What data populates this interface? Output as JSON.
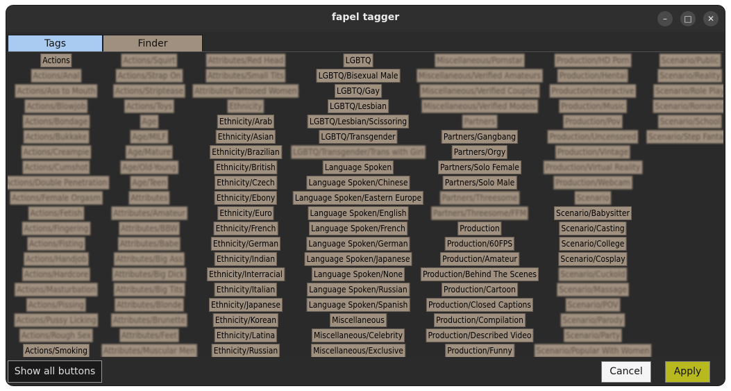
{
  "window": {
    "title": "fapel tagger",
    "minimize_glyph": "–",
    "maximize_glyph": "□",
    "close_glyph": "✕"
  },
  "tabs": [
    {
      "label": "Tags",
      "active": true
    },
    {
      "label": "Finder",
      "active": false
    }
  ],
  "tag_columns": [
    {
      "tags": [
        {
          "label": "Actions",
          "blurred": false
        },
        {
          "label": "Actions/Anal",
          "blurred": true
        },
        {
          "label": "Actions/Ass to Mouth",
          "blurred": true
        },
        {
          "label": "Actions/Blowjob",
          "blurred": true
        },
        {
          "label": "Actions/Bondage",
          "blurred": true
        },
        {
          "label": "Actions/Bukkake",
          "blurred": true
        },
        {
          "label": "Actions/Creampie",
          "blurred": true
        },
        {
          "label": "Actions/Cumshot",
          "blurred": true
        },
        {
          "label": "Actions/Double Penetration",
          "blurred": true
        },
        {
          "label": "Actions/Female Orgasm",
          "blurred": true
        },
        {
          "label": "Actions/Fetish",
          "blurred": true
        },
        {
          "label": "Actions/Fingering",
          "blurred": true
        },
        {
          "label": "Actions/Fisting",
          "blurred": true
        },
        {
          "label": "Actions/Handjob",
          "blurred": true
        },
        {
          "label": "Actions/Hardcore",
          "blurred": true
        },
        {
          "label": "Actions/Masturbation",
          "blurred": true
        },
        {
          "label": "Actions/Pissing",
          "blurred": true
        },
        {
          "label": "Actions/Pussy Licking",
          "blurred": true
        },
        {
          "label": "Actions/Rough Sex",
          "blurred": true
        },
        {
          "label": "Actions/Smoking",
          "blurred": false
        }
      ]
    },
    {
      "tags": [
        {
          "label": "Actions/Squirt",
          "blurred": true
        },
        {
          "label": "Actions/Strap On",
          "blurred": true
        },
        {
          "label": "Actions/Striptease",
          "blurred": true
        },
        {
          "label": "Actions/Toys",
          "blurred": true
        },
        {
          "label": "Age",
          "blurred": true
        },
        {
          "label": "Age/MILF",
          "blurred": true
        },
        {
          "label": "Age/Mature",
          "blurred": true
        },
        {
          "label": "Age/Old-Young",
          "blurred": true
        },
        {
          "label": "Age/Teen",
          "blurred": true
        },
        {
          "label": "Attributes",
          "blurred": true
        },
        {
          "label": "Attributes/Amateur",
          "blurred": true
        },
        {
          "label": "Attributes/BBW",
          "blurred": true
        },
        {
          "label": "Attributes/Babe",
          "blurred": true
        },
        {
          "label": "Attributes/Big Ass",
          "blurred": true
        },
        {
          "label": "Attributes/Big Dick",
          "blurred": true
        },
        {
          "label": "Attributes/Big Tits",
          "blurred": true
        },
        {
          "label": "Attributes/Blonde",
          "blurred": true
        },
        {
          "label": "Attributes/Brunette",
          "blurred": true
        },
        {
          "label": "Attributes/Feet",
          "blurred": true
        },
        {
          "label": "Attributes/Muscular Men",
          "blurred": true
        }
      ]
    },
    {
      "tags": [
        {
          "label": "Attributes/Red Head",
          "blurred": true
        },
        {
          "label": "Attributes/Small Tits",
          "blurred": true
        },
        {
          "label": "Attributes/Tattooed Women",
          "blurred": true
        },
        {
          "label": "Ethnicity",
          "blurred": true
        },
        {
          "label": "Ethnicity/Arab",
          "blurred": false
        },
        {
          "label": "Ethnicity/Asian",
          "blurred": false
        },
        {
          "label": "Ethnicity/Brazilian",
          "blurred": false
        },
        {
          "label": "Ethnicity/British",
          "blurred": false
        },
        {
          "label": "Ethnicity/Czech",
          "blurred": false
        },
        {
          "label": "Ethnicity/Ebony",
          "blurred": false
        },
        {
          "label": "Ethnicity/Euro",
          "blurred": false
        },
        {
          "label": "Ethnicity/French",
          "blurred": false
        },
        {
          "label": "Ethnicity/German",
          "blurred": false
        },
        {
          "label": "Ethnicity/Indian",
          "blurred": false
        },
        {
          "label": "Ethnicity/Interracial",
          "blurred": false
        },
        {
          "label": "Ethnicity/Italian",
          "blurred": false
        },
        {
          "label": "Ethnicity/Japanese",
          "blurred": false
        },
        {
          "label": "Ethnicity/Korean",
          "blurred": false
        },
        {
          "label": "Ethnicity/Latina",
          "blurred": false
        },
        {
          "label": "Ethnicity/Russian",
          "blurred": false
        }
      ]
    },
    {
      "tags": [
        {
          "label": "LGBTQ",
          "blurred": false
        },
        {
          "label": "LGBTQ/Bisexual Male",
          "blurred": false
        },
        {
          "label": "LGBTQ/Gay",
          "blurred": false
        },
        {
          "label": "LGBTQ/Lesbian",
          "blurred": false
        },
        {
          "label": "LGBTQ/Lesbian/Scissoring",
          "blurred": false
        },
        {
          "label": "LGBTQ/Transgender",
          "blurred": false
        },
        {
          "label": "LGBTQ/Transgender/Trans with Girl",
          "blurred": true
        },
        {
          "label": "Language Spoken",
          "blurred": false
        },
        {
          "label": "Language Spoken/Chinese",
          "blurred": false
        },
        {
          "label": "Language Spoken/Eastern Europe",
          "blurred": false
        },
        {
          "label": "Language Spoken/English",
          "blurred": false
        },
        {
          "label": "Language Spoken/French",
          "blurred": false
        },
        {
          "label": "Language Spoken/German",
          "blurred": false
        },
        {
          "label": "Language Spoken/Japanese",
          "blurred": false
        },
        {
          "label": "Language Spoken/None",
          "blurred": false
        },
        {
          "label": "Language Spoken/Russian",
          "blurred": false
        },
        {
          "label": "Language Spoken/Spanish",
          "blurred": false
        },
        {
          "label": "Miscellaneous",
          "blurred": false
        },
        {
          "label": "Miscellaneous/Celebrity",
          "blurred": false
        },
        {
          "label": "Miscellaneous/Exclusive",
          "blurred": false
        }
      ]
    },
    {
      "tags": [
        {
          "label": "Miscellaneous/Pornstar",
          "blurred": true
        },
        {
          "label": "Miscellaneous/Verified Amateurs",
          "blurred": true
        },
        {
          "label": "Miscellaneous/Verified Couples",
          "blurred": true
        },
        {
          "label": "Miscellaneous/Verified Models",
          "blurred": true
        },
        {
          "label": "Partners",
          "blurred": true
        },
        {
          "label": "Partners/Gangbang",
          "blurred": false
        },
        {
          "label": "Partners/Orgy",
          "blurred": false
        },
        {
          "label": "Partners/Solo Female",
          "blurred": false
        },
        {
          "label": "Partners/Solo Male",
          "blurred": false
        },
        {
          "label": "Partners/Threesome",
          "blurred": true
        },
        {
          "label": "Partners/Threesome/FFM",
          "blurred": true
        },
        {
          "label": "Production",
          "blurred": false
        },
        {
          "label": "Production/60FPS",
          "blurred": false
        },
        {
          "label": "Production/Amateur",
          "blurred": false
        },
        {
          "label": "Production/Behind The Scenes",
          "blurred": false
        },
        {
          "label": "Production/Cartoon",
          "blurred": false
        },
        {
          "label": "Production/Closed Captions",
          "blurred": false
        },
        {
          "label": "Production/Compilation",
          "blurred": false
        },
        {
          "label": "Production/Described Video",
          "blurred": false
        },
        {
          "label": "Production/Funny",
          "blurred": false
        }
      ]
    },
    {
      "tags": [
        {
          "label": "Production/HD Porn",
          "blurred": true
        },
        {
          "label": "Production/Hentai",
          "blurred": true
        },
        {
          "label": "Production/Interactive",
          "blurred": true
        },
        {
          "label": "Production/Music",
          "blurred": true
        },
        {
          "label": "Production/Pov",
          "blurred": true
        },
        {
          "label": "Production/Uncensored",
          "blurred": true
        },
        {
          "label": "Production/Vintage",
          "blurred": true
        },
        {
          "label": "Production/Virtual Reality",
          "blurred": true
        },
        {
          "label": "Production/Webcam",
          "blurred": true
        },
        {
          "label": "Scenario",
          "blurred": true
        },
        {
          "label": "Scenario/Babysitter",
          "blurred": false
        },
        {
          "label": "Scenario/Casting",
          "blurred": false
        },
        {
          "label": "Scenario/College",
          "blurred": false
        },
        {
          "label": "Scenario/Cosplay",
          "blurred": false
        },
        {
          "label": "Scenario/Cuckold",
          "blurred": true
        },
        {
          "label": "Scenario/Massage",
          "blurred": true
        },
        {
          "label": "Scenario/POV",
          "blurred": true
        },
        {
          "label": "Scenario/Parody",
          "blurred": true
        },
        {
          "label": "Scenario/Party",
          "blurred": true
        },
        {
          "label": "Scenario/Popular With Women",
          "blurred": true
        }
      ]
    },
    {
      "tags": [
        {
          "label": "Scenario/Public",
          "blurred": true
        },
        {
          "label": "Scenario/Reality",
          "blurred": true
        },
        {
          "label": "Scenario/Role Play",
          "blurred": true
        },
        {
          "label": "Scenario/Romantic",
          "blurred": true
        },
        {
          "label": "Scenario/School",
          "blurred": true
        },
        {
          "label": "Scenario/Step Fantasy",
          "blurred": true
        }
      ]
    }
  ],
  "bottom": {
    "show_all_label": "Show all buttons",
    "cancel_label": "Cancel",
    "apply_label": "Apply"
  },
  "colors": {
    "window_bg": "#2b2b2b",
    "tag_bg": "#a0907f",
    "tab_active_bg": "#a9cbf2",
    "tab_inactive_bg": "#a0907f",
    "apply_bg": "#b8b91e"
  }
}
